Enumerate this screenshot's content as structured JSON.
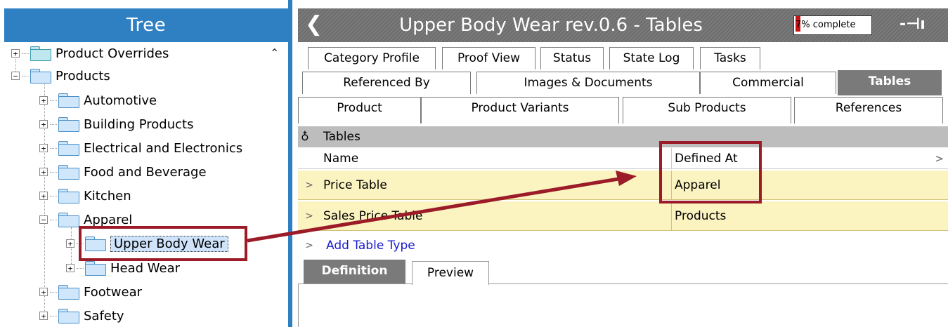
{
  "tree": {
    "title": "Tree",
    "items": [
      {
        "label": "Product Overrides"
      },
      {
        "label": "Products"
      },
      {
        "label": "Automotive"
      },
      {
        "label": "Building Products"
      },
      {
        "label": "Electrical and Electronics"
      },
      {
        "label": "Food and Beverage"
      },
      {
        "label": "Kitchen"
      },
      {
        "label": "Apparel"
      },
      {
        "label": "Upper Body Wear"
      },
      {
        "label": "Head Wear"
      },
      {
        "label": "Footwear"
      },
      {
        "label": "Safety"
      }
    ]
  },
  "header": {
    "title": "Upper Body Wear rev.0.6 - Tables",
    "progress_text": "7% complete",
    "progress_fraction": 0.07
  },
  "tabs": {
    "row1": [
      "Category Profile",
      "Proof View",
      "Status",
      "State Log",
      "Tasks"
    ],
    "row2": [
      "Referenced By",
      "Images & Documents",
      "Commercial",
      "Tables"
    ],
    "row3": [
      "Product",
      "Product Variants",
      "Sub Products",
      "References"
    ]
  },
  "tables_section": {
    "title": "Tables",
    "columns": [
      "Name",
      "Defined At"
    ],
    "rows": [
      {
        "name": "Price Table",
        "defined_at": "Apparel"
      },
      {
        "name": "Sales Price Table",
        "defined_at": "Products"
      }
    ],
    "add_label": "Add Table Type"
  },
  "subtabs": {
    "definition": "Definition",
    "preview": "Preview"
  },
  "colors": {
    "tree_header": "#2f80c3",
    "title_bar": "#7a7a7a",
    "annotation": "#9b1c28",
    "row_highlight": "#fbf3c0"
  }
}
